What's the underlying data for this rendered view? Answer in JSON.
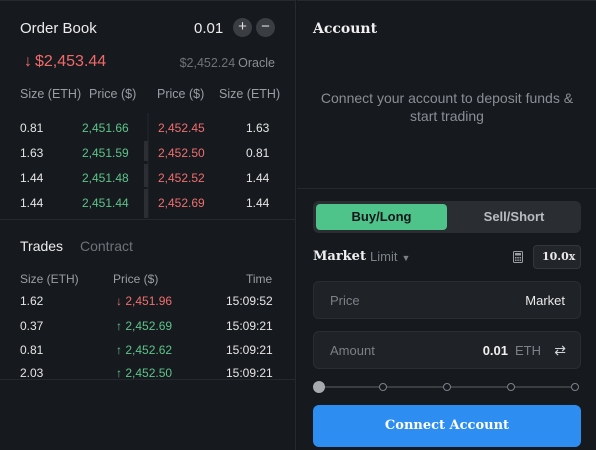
{
  "order_book": {
    "title": "Order Book",
    "size_step": "0.01",
    "plus_label": "+",
    "minus_label": "−",
    "last_price": "$2,453.44",
    "last_price_arrow": "↓",
    "oracle_price": "$2,452.24",
    "oracle_label": "Oracle",
    "headers": [
      "Size (ETH)",
      "Price ($)",
      "Price ($)",
      "Size (ETH)"
    ],
    "rows": [
      {
        "bid_size": "0.81",
        "bid_price": "2,451.66",
        "ask_price": "2,452.45",
        "ask_size": "1.63"
      },
      {
        "bid_size": "1.63",
        "bid_price": "2,451.59",
        "ask_price": "2,452.50",
        "ask_size": "0.81"
      },
      {
        "bid_size": "1.44",
        "bid_price": "2,451.48",
        "ask_price": "2,452.52",
        "ask_size": "1.44"
      },
      {
        "bid_size": "1.44",
        "bid_price": "2,451.44",
        "ask_price": "2,452.69",
        "ask_size": "1.44"
      }
    ]
  },
  "trades": {
    "tab_trades": "Trades",
    "tab_contract": "Contract",
    "headers": [
      "Size (ETH)",
      "Price ($)",
      "Time"
    ],
    "rows": [
      {
        "size": "1.62",
        "arrow": "↓",
        "price": "2,451.96",
        "time": "15:09:52",
        "side": "sell"
      },
      {
        "size": "0.37",
        "arrow": "↑",
        "price": "2,452.69",
        "time": "15:09:21",
        "side": "buy"
      },
      {
        "size": "0.81",
        "arrow": "↑",
        "price": "2,452.62",
        "time": "15:09:21",
        "side": "buy"
      },
      {
        "size": "2.03",
        "arrow": "↑",
        "price": "2,452.50",
        "time": "15:09:21",
        "side": "buy"
      }
    ]
  },
  "account": {
    "title": "Account",
    "message": "Connect your account to deposit funds & start trading",
    "buy_label": "Buy/Long",
    "sell_label": "Sell/Short",
    "order_type_market": "Market",
    "order_type_limit": "Limit",
    "leverage": "10.0x",
    "price_label": "Price",
    "price_value": "Market",
    "amount_label": "Amount",
    "amount_value": "0.01",
    "amount_unit": "ETH",
    "slider_value_percent": 0,
    "connect_label": "Connect Account"
  },
  "colors": {
    "buy_green": "#4ec38a",
    "sell_red": "#ef6f6f",
    "accent_blue": "#2e8df0",
    "background": "#16191d"
  }
}
